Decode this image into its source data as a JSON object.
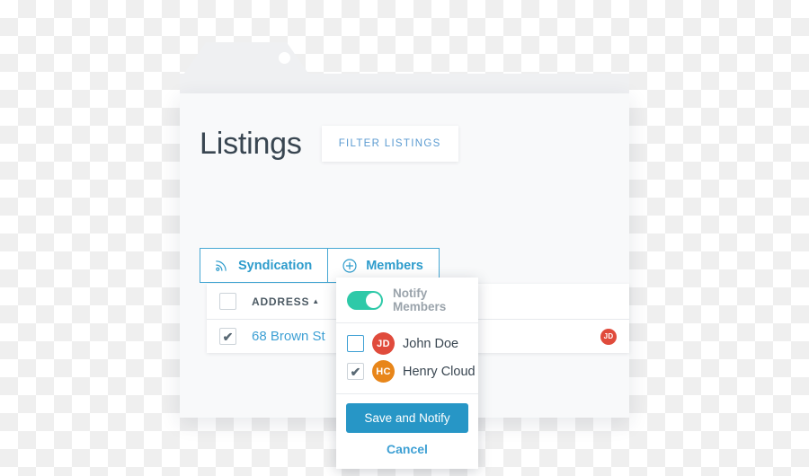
{
  "window": {
    "title": "Listings"
  },
  "header": {
    "title": "Listings",
    "filter_button": "FILTER LISTINGS"
  },
  "segmented": {
    "syndication": {
      "label": "Syndication",
      "icon": "rss-icon"
    },
    "members": {
      "label": "Members",
      "icon": "plus-circle-icon"
    }
  },
  "table": {
    "columns": [
      {
        "key": "select",
        "label": ""
      },
      {
        "key": "address",
        "label": "ADDRESS",
        "sort": "▲"
      }
    ],
    "rows": [
      {
        "selected": true,
        "address": "68 Brown St",
        "avatar": {
          "initials": "JD",
          "color": "#e04b3c"
        }
      }
    ]
  },
  "popover": {
    "notify": {
      "label": "Notify Members",
      "enabled": true,
      "color": "#2ec9a8"
    },
    "members": [
      {
        "initials": "JD",
        "name": "John Doe",
        "color": "#e04b3c",
        "checked": false
      },
      {
        "initials": "HC",
        "name": "Henry Cloud",
        "color": "#e8861a",
        "checked": true
      }
    ],
    "save_label": "Save and Notify",
    "cancel_label": "Cancel",
    "save_color": "#2796c6"
  },
  "theme": {
    "accent_blue": "#3ea0d4",
    "teal": "#2ec9a8",
    "title_color": "#394651",
    "card_bg": "#f8f9fa",
    "folder_gray": "#eff0f2"
  }
}
